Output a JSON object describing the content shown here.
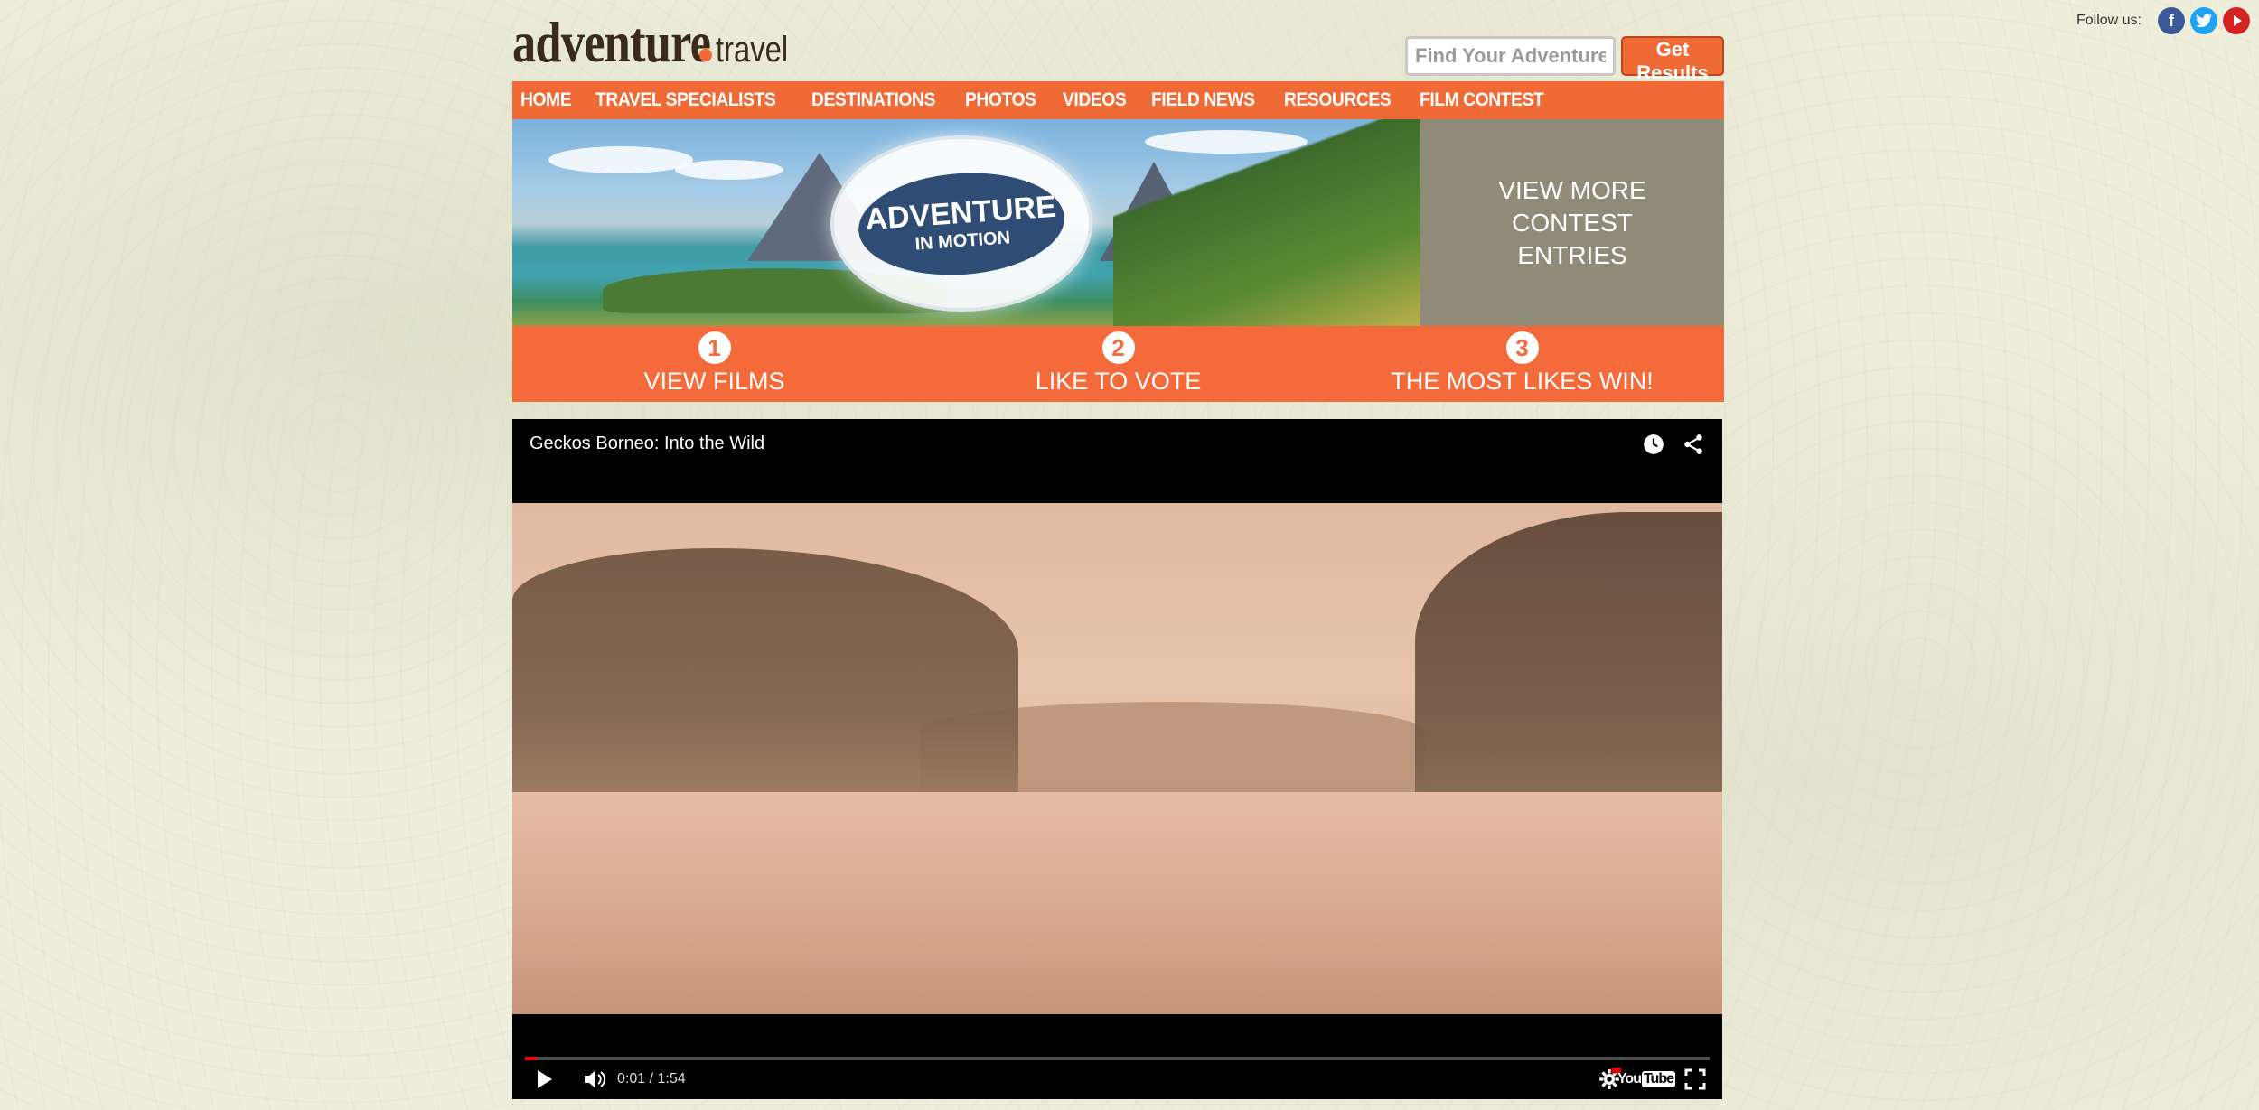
{
  "social": {
    "follow_label": "Follow us:",
    "icons": [
      "facebook-icon",
      "twitter-icon",
      "youtube-icon"
    ]
  },
  "logo": {
    "main": "adventure",
    "sub": "travel"
  },
  "search": {
    "placeholder": "Find Your Adventure.",
    "button_label": "Get Results"
  },
  "nav": {
    "items": [
      "HOME",
      "TRAVEL SPECIALISTS",
      "DESTINATIONS",
      "PHOTOS",
      "VIDEOS",
      "FIELD NEWS",
      "RESOURCES",
      "FILM CONTEST"
    ]
  },
  "banner": {
    "badge_line1": "ADVENTURE",
    "badge_line2": "IN MOTION",
    "more_entries": "VIEW MORE\nCONTEST\nENTRIES"
  },
  "steps": [
    {
      "num": "1",
      "label": "VIEW FILMS"
    },
    {
      "num": "2",
      "label": "LIKE TO VOTE"
    },
    {
      "num": "3",
      "label": "THE MOST LIKES WIN!"
    }
  ],
  "video": {
    "title": "Geckos Borneo: Into the Wild",
    "time": "0:01 / 1:54",
    "progress_fraction": 0.01,
    "youtube_label": "You",
    "youtube_label_box": "Tube"
  },
  "colors": {
    "accent": "#f06a35",
    "entries_bg": "#908b78"
  }
}
